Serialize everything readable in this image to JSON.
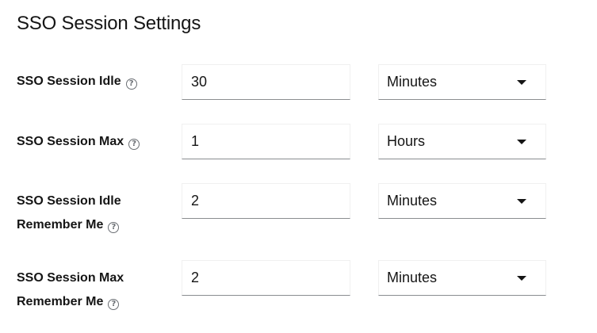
{
  "section": {
    "title": "SSO Session Settings"
  },
  "rows": [
    {
      "label_line1": "SSO Session Idle",
      "label_line2": "",
      "value": "30",
      "unit": "Minutes"
    },
    {
      "label_line1": "SSO Session Max",
      "label_line2": "",
      "value": "1",
      "unit": "Hours"
    },
    {
      "label_line1": "SSO Session Idle",
      "label_line2": "Remember Me",
      "value": "2",
      "unit": "Minutes"
    },
    {
      "label_line1": "SSO Session Max",
      "label_line2": "Remember Me",
      "value": "2",
      "unit": "Minutes"
    }
  ],
  "icons": {
    "help": "help-circle-icon",
    "dropdown": "caret-down-icon"
  }
}
